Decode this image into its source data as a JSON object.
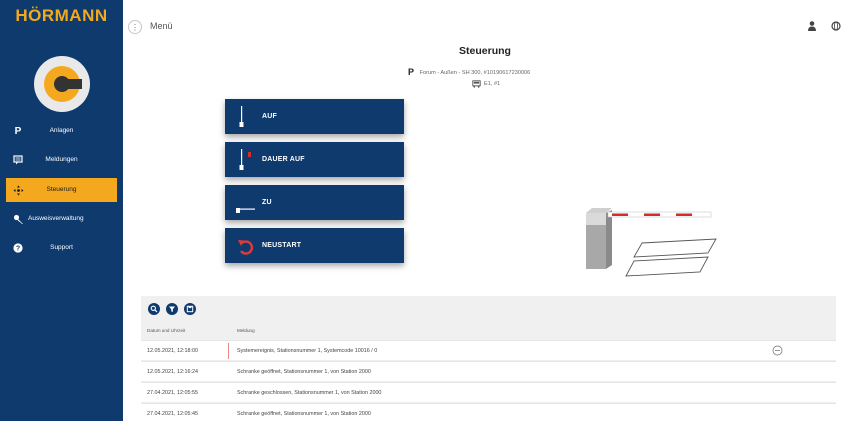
{
  "brand": {
    "name": "HÖRMANN"
  },
  "colors": {
    "sidebar": "#0e3a6e",
    "accent": "#f4a81d",
    "button": "#0e3a6e",
    "barrier_red": "#d42b2b"
  },
  "sidebar": {
    "items": [
      {
        "icon": "parking-icon",
        "label": "Anlagen"
      },
      {
        "icon": "messages-icon",
        "label": "Meldungen"
      },
      {
        "icon": "move-icon",
        "label": "Steuerung",
        "active": true
      },
      {
        "icon": "key-icon",
        "label": "Ausweisverwaltung"
      },
      {
        "icon": "help-icon",
        "label": "Support"
      }
    ]
  },
  "topbar": {
    "menu_label": "Menü",
    "menu_icon": "more-vertical-icon",
    "user_icon": "user-icon",
    "globe_icon": "globe-icon"
  },
  "header": {
    "title": "Steuerung",
    "location_mark": "P",
    "location": "Forum - Außen - SH 300, #10190617230006",
    "device": "E1, #1",
    "device_icon": "vehicle-icon"
  },
  "controls": [
    {
      "label": "AUF",
      "icon": "barrier-up-icon"
    },
    {
      "label": "DAUER AUF",
      "icon": "barrier-permanent-up-icon"
    },
    {
      "label": "ZU",
      "icon": "barrier-down-icon"
    },
    {
      "label": "NEUSTART",
      "icon": "restart-icon"
    }
  ],
  "log": {
    "tools": [
      {
        "icon": "search-icon"
      },
      {
        "icon": "filter-icon"
      },
      {
        "icon": "export-icon"
      }
    ],
    "columns": [
      "Datum und Uhrzeit",
      "Meldung"
    ],
    "rows": [
      {
        "datetime": "12.05.2021, 12:18:00",
        "message": "Systemereignis, Stationsnummer 1, Systemcode 10016 / 0",
        "action_icon": "minus-circle-icon"
      },
      {
        "datetime": "12.05.2021, 12:16:24",
        "message": "Schranke geöffnet, Stationsnummer 1, von Station 2000"
      },
      {
        "datetime": "27.04.2021, 12:05:55",
        "message": "Schranke geschlossen, Stationsnummer 1, von Station 2000"
      },
      {
        "datetime": "27.04.2021, 12:05:45",
        "message": "Schranke geöffnet, Stationsnummer 1, von Station 2000"
      }
    ]
  }
}
